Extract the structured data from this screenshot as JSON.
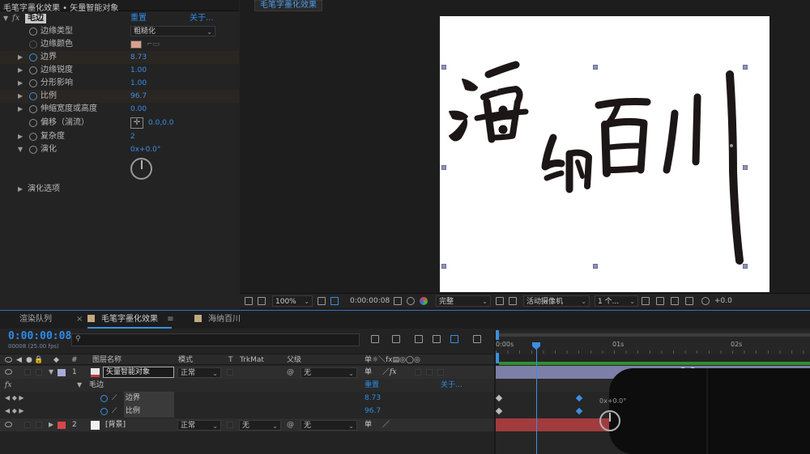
{
  "effect_controls": {
    "panel_title": "毛笔字墨化效果 • 矢量智能对象",
    "effect_name": "毛边",
    "reset_label": "重置",
    "about_label": "关于...",
    "properties": [
      {
        "label": "边缘类型",
        "value": "粗糙化"
      },
      {
        "label": "边缘颜色",
        "value": ""
      },
      {
        "label": "边界",
        "value": "8.73"
      },
      {
        "label": "边缘锐度",
        "value": "1.00"
      },
      {
        "label": "分形影响",
        "value": "1.00"
      },
      {
        "label": "比例",
        "value": "96.7"
      },
      {
        "label": "伸缩宽度或高度",
        "value": "0.00"
      },
      {
        "label": "偏移（湍流）",
        "value": "0.0,0.0"
      },
      {
        "label": "复杂度",
        "value": "2"
      },
      {
        "label": "演化",
        "value": "0x+0.0°"
      },
      {
        "label": "演化选项",
        "value": ""
      }
    ],
    "edge_color": "#d9a08f"
  },
  "viewer": {
    "comp_tab": "毛笔字墨化效果",
    "canvas_text": "海纳百川",
    "toolbar": {
      "zoom": "100%",
      "timecode": "0:00:00:08",
      "resolution": "完整",
      "camera": "活动摄像机",
      "views": "1 个...",
      "exposure": "+0.0"
    }
  },
  "timeline": {
    "tabs": [
      {
        "label": "渲染队列"
      },
      {
        "label": "毛笔字墨化效果",
        "color": "#c2a882"
      },
      {
        "label": "海纳百川",
        "color": "#c2a882"
      }
    ],
    "current_time": "0:00:00:08",
    "current_time_sub": "00008 (25.00 fps)",
    "columns": {
      "num": "#",
      "layer_name": "图层名称",
      "mode": "模式",
      "t": "T",
      "trkmat": "TrkMat",
      "parent": "父级",
      "switches": "单☼＼fx▤◎◯◎"
    },
    "ruler_labels": [
      "0:00s",
      "01s",
      "02s"
    ],
    "layers": [
      {
        "num": "1",
        "name": "矢量智能对象",
        "mode": "正常",
        "trkmat": "",
        "parent": "无",
        "label_color": "#a9a9d8"
      },
      {
        "num": "2",
        "name": "[背景]",
        "mode": "正常",
        "trkmat": "无",
        "parent": "无",
        "label_color": "#d9464a"
      }
    ],
    "sub_rows": {
      "fx": "fx",
      "effect": "毛边",
      "reset": "重置",
      "about": "关于...",
      "border_label": "边界",
      "border_value": "8.73",
      "scale_label": "比例",
      "scale_value": "96.7"
    },
    "overlay_readout": "0x+0.0°"
  }
}
